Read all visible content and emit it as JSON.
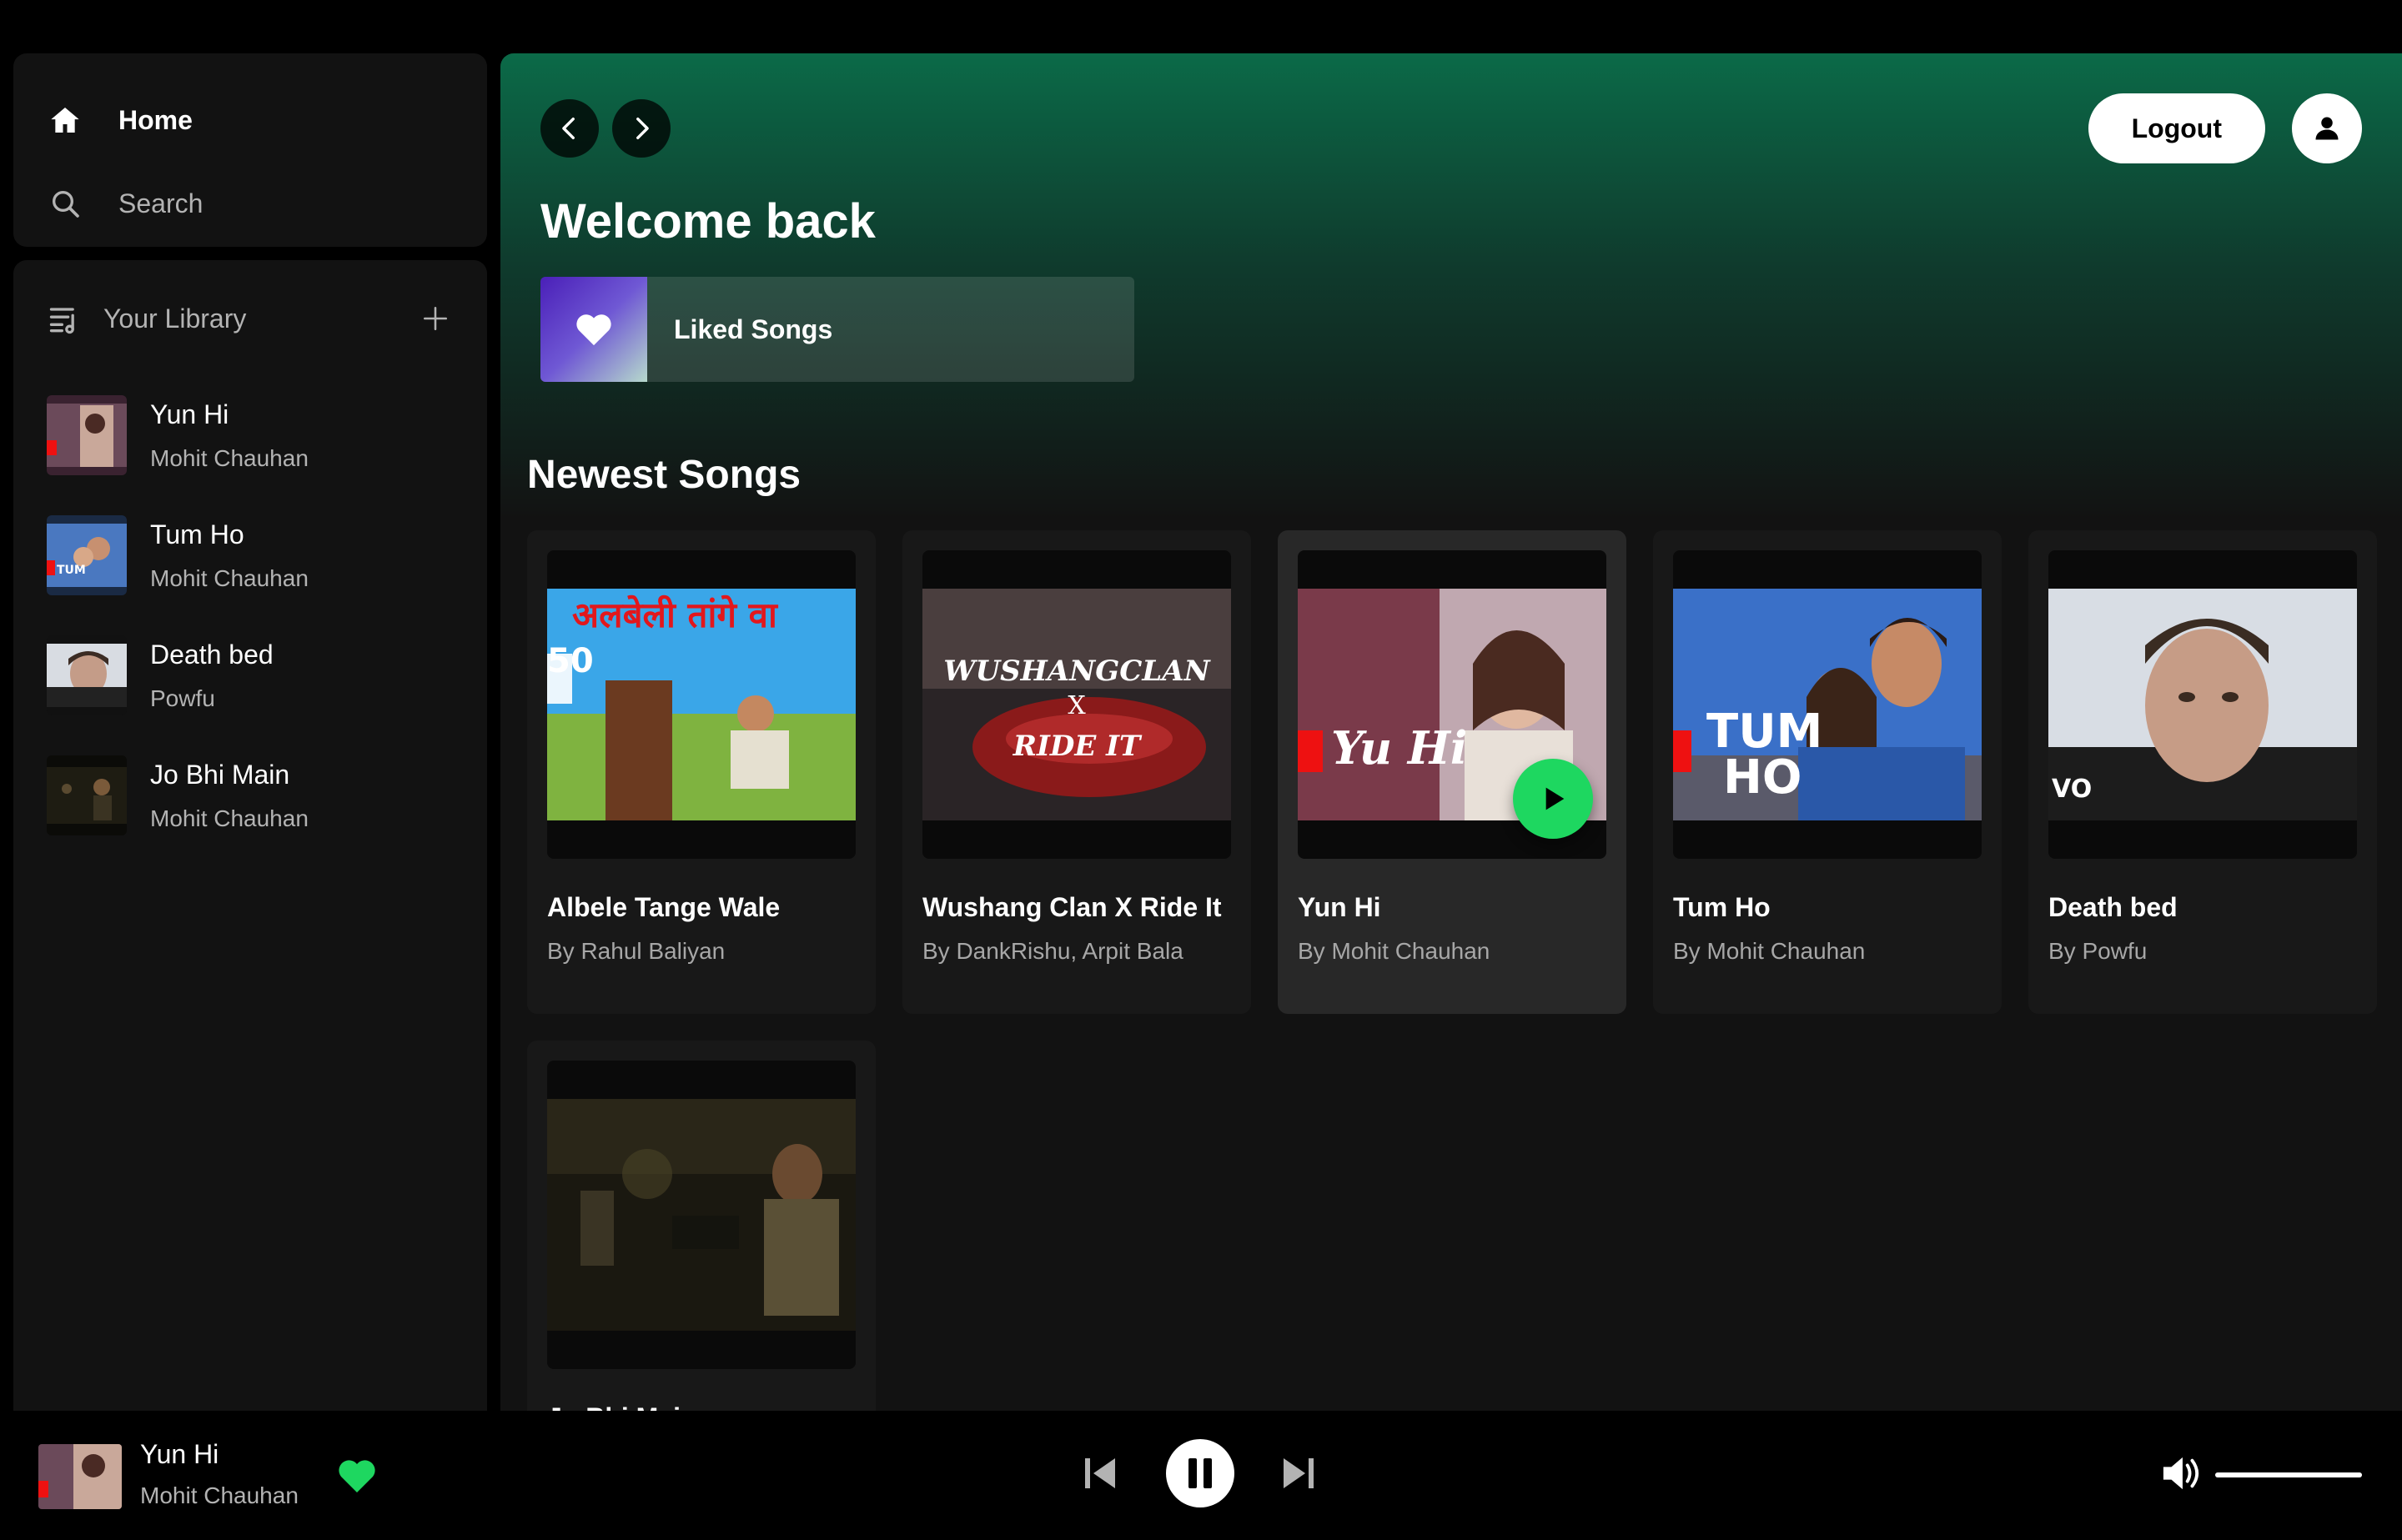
{
  "nav": {
    "home_label": "Home",
    "search_label": "Search"
  },
  "library": {
    "title": "Your Library",
    "items": [
      {
        "title": "Yun Hi",
        "artist": "Mohit Chauhan"
      },
      {
        "title": "Tum Ho",
        "artist": "Mohit Chauhan"
      },
      {
        "title": "Death bed",
        "artist": "Powfu"
      },
      {
        "title": "Jo Bhi Main",
        "artist": "Mohit Chauhan"
      }
    ]
  },
  "header": {
    "logout_label": "Logout",
    "welcome": "Welcome back",
    "liked_label": "Liked Songs"
  },
  "newest": {
    "title": "Newest Songs",
    "cards": [
      {
        "title": "Albele Tange Wale",
        "by": "By Rahul Baliyan",
        "art_text": "अलबेली तांगे वा"
      },
      {
        "title": "Wushang Clan X Ride It",
        "by": "By DankRishu, Arpit Bala",
        "art_text": "WUSHANGCLAN X RIDE IT"
      },
      {
        "title": "Yun Hi",
        "by": "By Mohit Chauhan",
        "art_text": "Yu Hi"
      },
      {
        "title": "Tum Ho",
        "by": "By Mohit Chauhan",
        "art_text": "TUM HO"
      },
      {
        "title": "Death bed",
        "by": "By Powfu",
        "art_text": "VO"
      },
      {
        "title": "Jo Bhi Main",
        "by": "",
        "art_text": ""
      }
    ]
  },
  "player": {
    "title": "Yun Hi",
    "artist": "Mohit Chauhan",
    "liked": true,
    "state": "playing",
    "volume": 1.0
  },
  "colors": {
    "accent": "#1ed760",
    "header_gradient_top": "#0b6a48",
    "panel": "#121212"
  }
}
